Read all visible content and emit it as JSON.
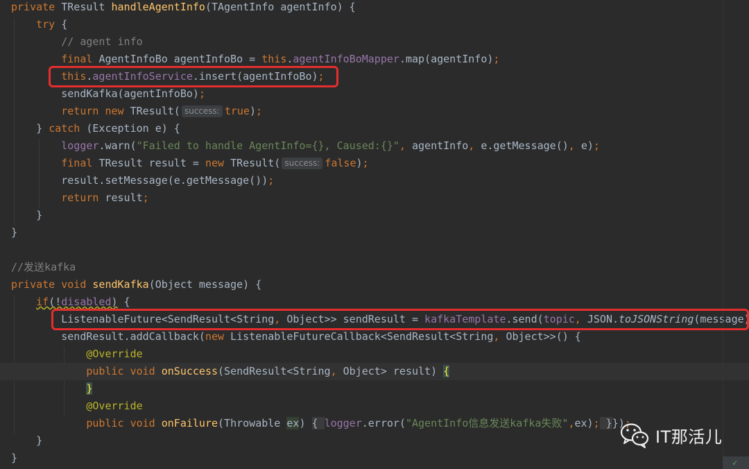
{
  "code": {
    "lines": [
      {
        "current": false,
        "tokens": [
          {
            "t": "private ",
            "c": "kw"
          },
          {
            "t": "TResult "
          },
          {
            "t": "handleAgentInfo",
            "c": "fn"
          },
          {
            "t": "(TAgentInfo agentInfo) {"
          }
        ]
      },
      {
        "current": false,
        "tokens": [
          {
            "t": "    "
          },
          {
            "t": "try ",
            "c": "kw"
          },
          {
            "t": "{"
          }
        ]
      },
      {
        "current": false,
        "tokens": [
          {
            "t": "        "
          },
          {
            "t": "// agent info",
            "c": "cm"
          }
        ]
      },
      {
        "current": false,
        "tokens": [
          {
            "t": "        "
          },
          {
            "t": "final ",
            "c": "kw"
          },
          {
            "t": "AgentInfoBo agentInfoBo = "
          },
          {
            "t": "this",
            "c": "kw"
          },
          {
            "t": "."
          },
          {
            "t": "agentInfoBoMapper",
            "c": "fld"
          },
          {
            "t": ".map(agentInfo)"
          },
          {
            "t": ";",
            "c": "kw"
          }
        ]
      },
      {
        "current": false,
        "tokens": [
          {
            "t": "        "
          },
          {
            "t": "this",
            "c": "kw"
          },
          {
            "t": "."
          },
          {
            "t": "agentInfoService",
            "c": "fld"
          },
          {
            "t": ".insert(agentInfoBo)"
          },
          {
            "t": ";",
            "c": "kw"
          }
        ]
      },
      {
        "current": false,
        "tokens": [
          {
            "t": "        sendKafka(agentInfoBo)"
          },
          {
            "t": ";",
            "c": "kw"
          }
        ]
      },
      {
        "current": false,
        "tokens": [
          {
            "t": "        "
          },
          {
            "t": "return new ",
            "c": "kw"
          },
          {
            "t": "TResult("
          },
          {
            "t": "success:",
            "c": "hint"
          },
          {
            "t": "true",
            "c": "kw"
          },
          {
            "t": ")"
          },
          {
            "t": ";",
            "c": "kw"
          }
        ]
      },
      {
        "current": false,
        "tokens": [
          {
            "t": "    } "
          },
          {
            "t": "catch ",
            "c": "kw"
          },
          {
            "t": "(Exception e) {"
          }
        ]
      },
      {
        "current": false,
        "tokens": [
          {
            "t": "        "
          },
          {
            "t": "logger",
            "c": "fld"
          },
          {
            "t": ".warn("
          },
          {
            "t": "\"Failed to handle AgentInfo={}, Caused:{}\"",
            "c": "str"
          },
          {
            "t": ", ",
            "c": "kw"
          },
          {
            "t": "agentInfo"
          },
          {
            "t": ", ",
            "c": "kw"
          },
          {
            "t": "e.getMessage()"
          },
          {
            "t": ", ",
            "c": "kw"
          },
          {
            "t": "e)"
          },
          {
            "t": ";",
            "c": "kw"
          }
        ]
      },
      {
        "current": false,
        "tokens": [
          {
            "t": "        "
          },
          {
            "t": "final ",
            "c": "kw"
          },
          {
            "t": "TResult result = "
          },
          {
            "t": "new ",
            "c": "kw"
          },
          {
            "t": "TResult("
          },
          {
            "t": "success:",
            "c": "hint"
          },
          {
            "t": "false",
            "c": "kw"
          },
          {
            "t": ")"
          },
          {
            "t": ";",
            "c": "kw"
          }
        ]
      },
      {
        "current": false,
        "tokens": [
          {
            "t": "        result.setMessage(e.getMessage())"
          },
          {
            "t": ";",
            "c": "kw"
          }
        ]
      },
      {
        "current": false,
        "tokens": [
          {
            "t": "        "
          },
          {
            "t": "return ",
            "c": "kw"
          },
          {
            "t": "result"
          },
          {
            "t": ";",
            "c": "kw"
          }
        ]
      },
      {
        "current": false,
        "tokens": [
          {
            "t": "    }"
          }
        ]
      },
      {
        "current": false,
        "tokens": [
          {
            "t": "}"
          }
        ]
      },
      {
        "current": false,
        "tokens": []
      },
      {
        "current": false,
        "tokens": [
          {
            "t": "//发送kafka",
            "c": "cm"
          }
        ]
      },
      {
        "current": false,
        "tokens": [
          {
            "t": "private void ",
            "c": "kw"
          },
          {
            "t": "sendKafka",
            "c": "fn"
          },
          {
            "t": "(Object message) {"
          }
        ]
      },
      {
        "current": false,
        "tokens": [
          {
            "t": "    "
          },
          {
            "t": "if",
            "c": "kw squiggle"
          },
          {
            "t": "(!",
            "c": "squiggle"
          },
          {
            "t": "disabled",
            "c": "fld squiggle"
          },
          {
            "t": ")",
            "c": "squiggle"
          },
          {
            "t": " {"
          }
        ]
      },
      {
        "current": false,
        "tokens": [
          {
            "t": "        ListenableFuture<SendResult<String"
          },
          {
            "t": ", ",
            "c": "kw"
          },
          {
            "t": "Object>> sendResult = "
          },
          {
            "t": "kafkaTemplate",
            "c": "fld"
          },
          {
            "t": ".send("
          },
          {
            "t": "topic",
            "c": "fld"
          },
          {
            "t": ", ",
            "c": "kw"
          },
          {
            "t": "JSON."
          },
          {
            "t": "toJSONString",
            "c": "st"
          },
          {
            "t": "(message))"
          },
          {
            "t": ";",
            "c": "kw"
          }
        ]
      },
      {
        "current": false,
        "tokens": [
          {
            "t": "        sendResult.addCallback("
          },
          {
            "t": "new ",
            "c": "kw"
          },
          {
            "t": "ListenableFutureCallback<SendResult<String"
          },
          {
            "t": ", ",
            "c": "kw"
          },
          {
            "t": "Object>>() {"
          }
        ]
      },
      {
        "current": false,
        "tokens": [
          {
            "t": "            "
          },
          {
            "t": "@Override",
            "c": "ann"
          }
        ]
      },
      {
        "current": true,
        "tokens": [
          {
            "t": "            "
          },
          {
            "t": "public void ",
            "c": "kw"
          },
          {
            "t": "onSuccess",
            "c": "fn"
          },
          {
            "t": "(SendResult<String"
          },
          {
            "t": ", ",
            "c": "kw"
          },
          {
            "t": "Object> result) "
          },
          {
            "t": "{",
            "c": "brace-match"
          }
        ]
      },
      {
        "current": false,
        "tokens": [
          {
            "t": "            "
          },
          {
            "t": "}",
            "c": "brace-match"
          }
        ]
      },
      {
        "current": false,
        "tokens": [
          {
            "t": "            "
          },
          {
            "t": "@Override",
            "c": "ann"
          }
        ]
      },
      {
        "current": false,
        "tokens": [
          {
            "t": "            "
          },
          {
            "t": "public void ",
            "c": "kw"
          },
          {
            "t": "onFailure",
            "c": "fn"
          },
          {
            "t": "(Throwable "
          },
          {
            "t": "ex",
            "c": "var-hl"
          },
          {
            "t": ") "
          },
          {
            "t": "{ ",
            "c": "fold"
          },
          {
            "t": "logger",
            "c": "fld"
          },
          {
            "t": ".error("
          },
          {
            "t": "\"AgentInfo信息发送kafka失败\"",
            "c": "str"
          },
          {
            "t": ",",
            "c": "kw"
          },
          {
            "t": "ex)"
          },
          {
            "t": ";",
            "c": "kw"
          },
          {
            "t": " }",
            "c": "fold"
          },
          {
            "t": "})"
          },
          {
            "t": ";",
            "c": "kw"
          }
        ]
      },
      {
        "current": false,
        "tokens": [
          {
            "t": "    }"
          }
        ]
      },
      {
        "current": false,
        "tokens": [
          {
            "t": "}"
          }
        ]
      }
    ]
  },
  "watermark": {
    "text": "IT那活儿",
    "icon": "wechat-icon"
  },
  "status": {
    "icon": "inspection-check-icon"
  }
}
